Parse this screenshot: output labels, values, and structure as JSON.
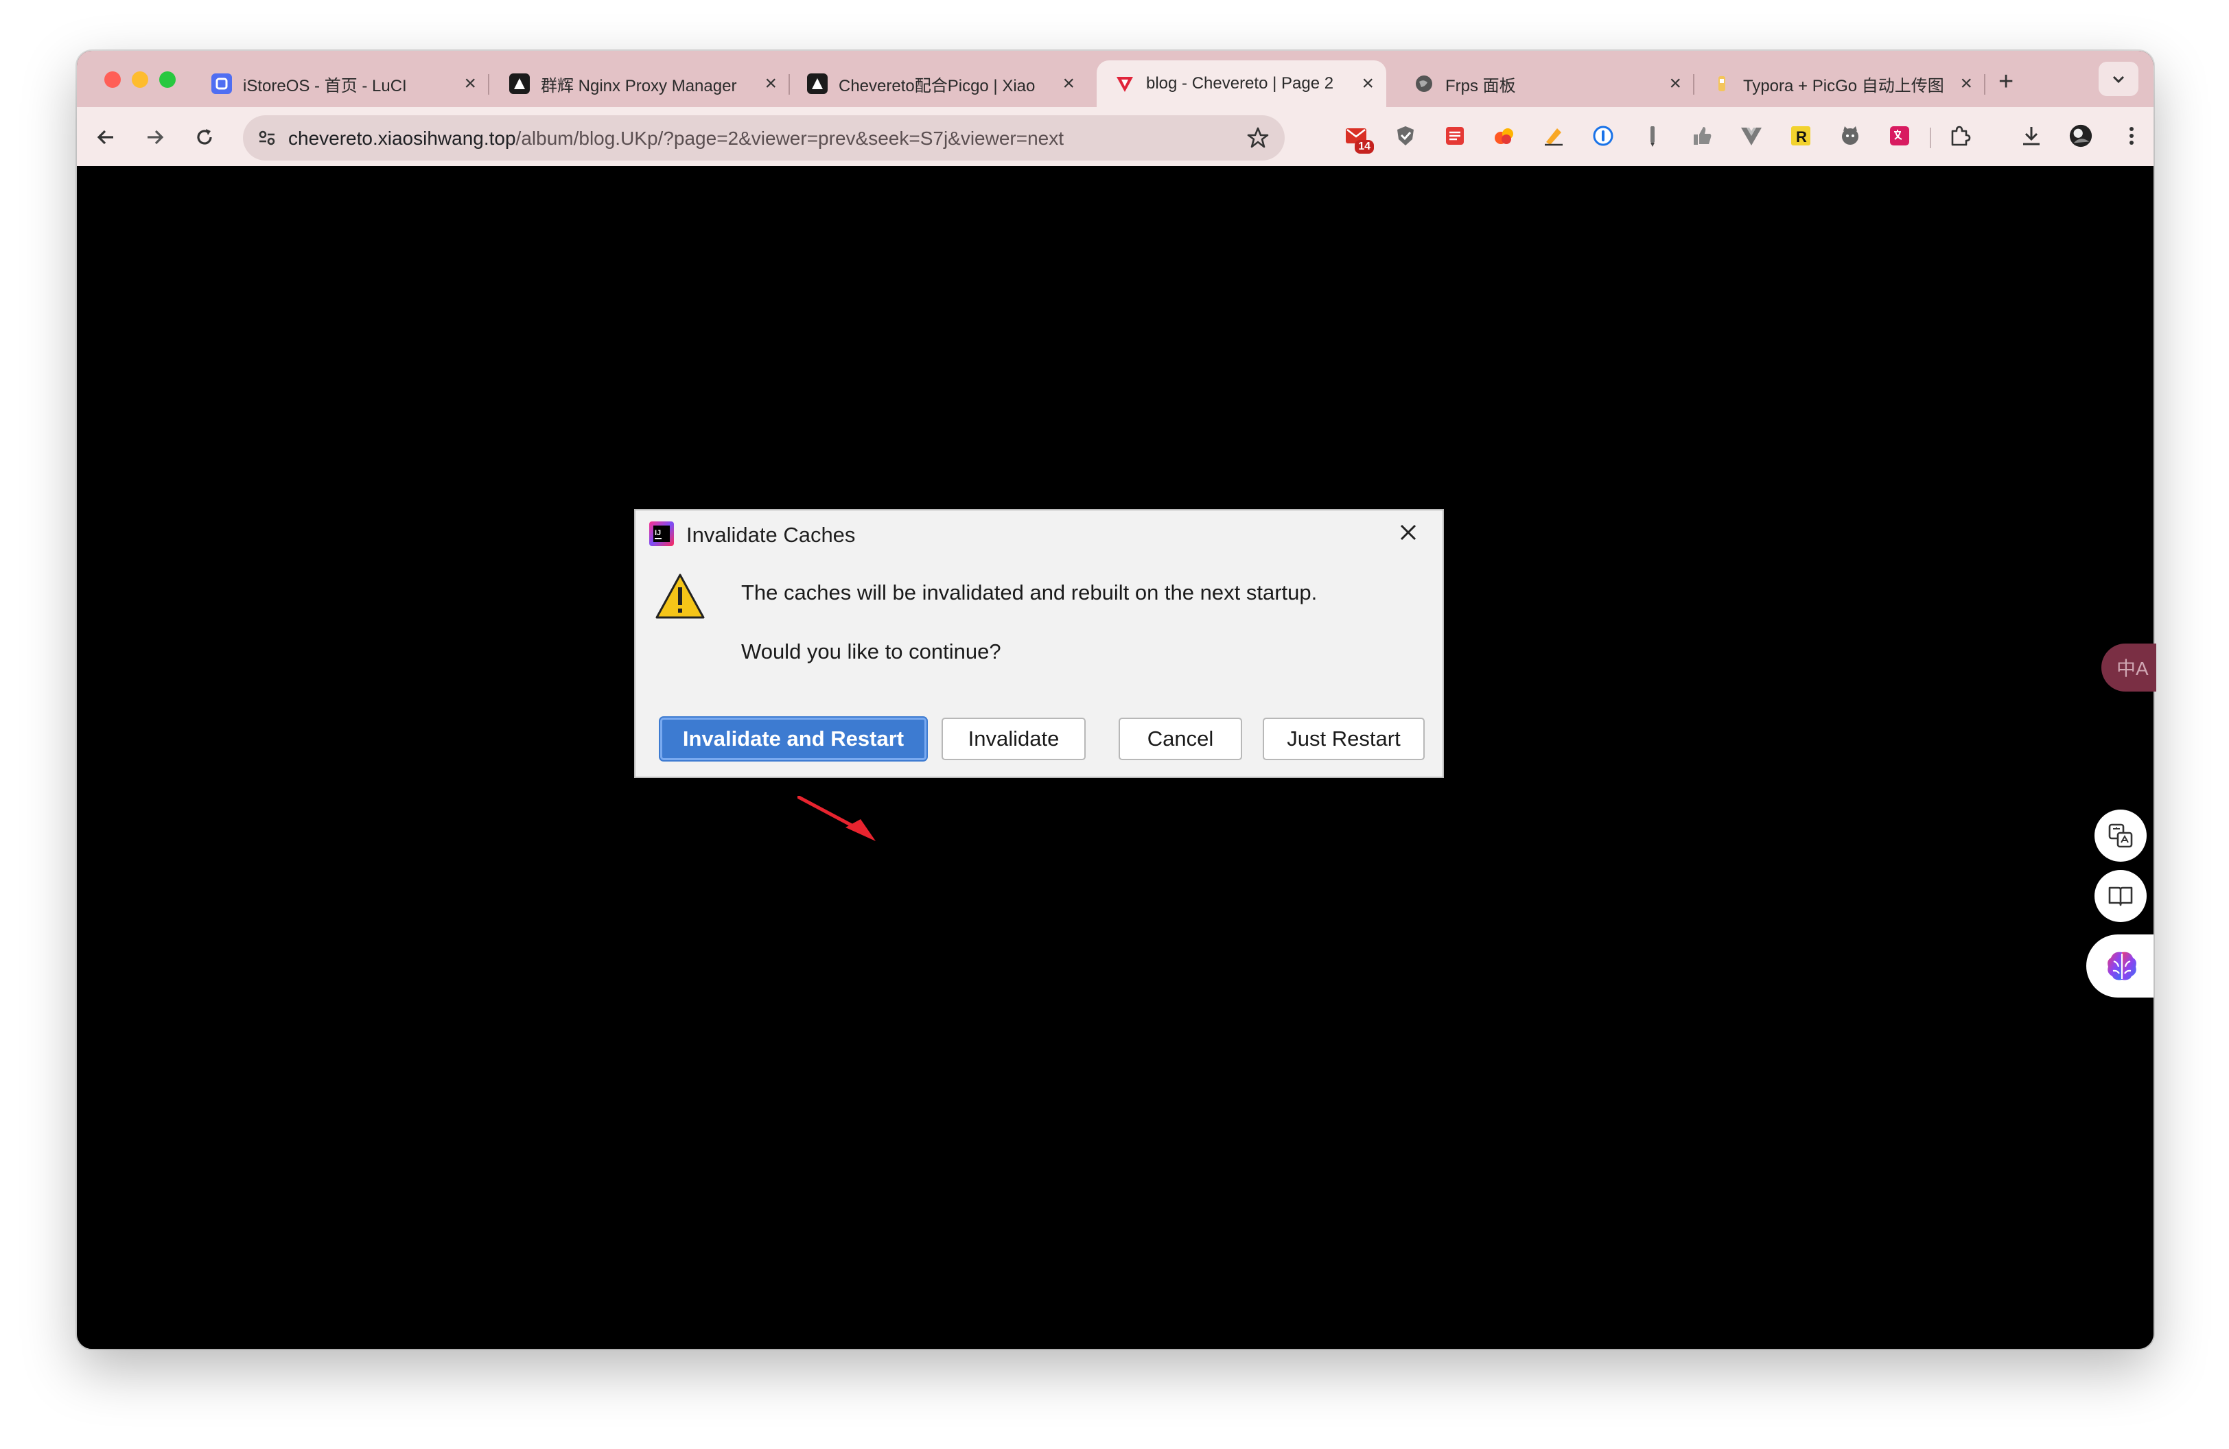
{
  "browser": {
    "tabs": [
      {
        "title": "iStoreOS - 首页 - LuCI",
        "icon": "istoreos-icon",
        "active": false
      },
      {
        "title": "群辉 Nginx Proxy Manager",
        "icon": "nginx-proxy-manager-icon",
        "active": false
      },
      {
        "title": "Chevereto配合Picgo | Xiao",
        "icon": "chevereto-cat-icon",
        "active": false
      },
      {
        "title": "blog - Chevereto | Page 2",
        "icon": "chevereto-v-icon",
        "active": true
      },
      {
        "title": "Frps 面板",
        "icon": "globe-icon",
        "active": false
      },
      {
        "title": "Typora + PicGo 自动上传图",
        "icon": "typora-icon",
        "active": false
      }
    ],
    "url_host": "chevereto.xiaosihwang.top",
    "url_path": "/album/blog.UKp/?page=2&viewer=prev&seek=S7j&viewer=next",
    "mail_badge": "14"
  },
  "dialog": {
    "title": "Invalidate Caches",
    "message": "The caches will be invalidated and rebuilt on the next startup.",
    "question": "Would you like to continue?",
    "buttons": {
      "invalidate_restart": "Invalidate and Restart",
      "invalidate": "Invalidate",
      "cancel": "Cancel",
      "just_restart": "Just Restart"
    }
  },
  "side": {
    "translate_label": "中A"
  },
  "colors": {
    "tab_strip": "#e3c2c6",
    "toolbar": "#f6eaea",
    "primary_button": "#3d7bd1",
    "annotation_arrow": "#e8242f"
  }
}
